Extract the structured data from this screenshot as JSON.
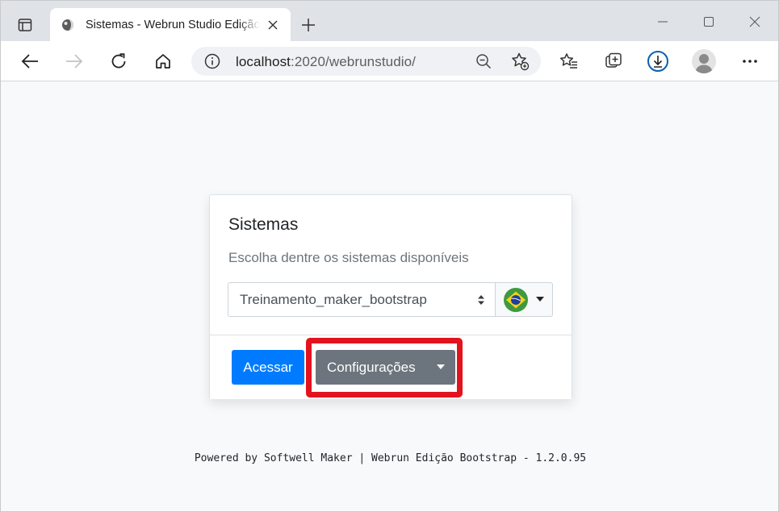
{
  "browser": {
    "tab_title": "Sistemas - Webrun Studio Edição Bootstrap",
    "address_host": "localhost",
    "address_path": ":2020/webrunstudio/"
  },
  "icons": {
    "tab_actions": "tab-actions-icon",
    "favicon": "favicon-icon",
    "tab_close": "close-icon",
    "new_tab": "plus-icon",
    "minimize": "minimize-icon",
    "maximize": "maximize-icon",
    "window_close": "close-icon",
    "back": "arrow-left-icon",
    "forward": "arrow-right-icon",
    "refresh": "refresh-icon",
    "home": "home-icon",
    "site_info": "info-icon",
    "zoom": "zoom-out-icon",
    "add_favorite": "star-add-icon",
    "favorites": "favorites-icon",
    "collections": "collections-icon",
    "downloads": "download-icon",
    "profile": "profile-icon",
    "more": "more-icon",
    "language_flag": "brazil-flag-icon"
  },
  "card": {
    "title": "Sistemas",
    "subtitle": "Escolha dentre os sistemas disponíveis",
    "system_select_value": "Treinamento_maker_bootstrap",
    "acessar_label": "Acessar",
    "config_label": "Configurações"
  },
  "footer": {
    "text": "Powered by Softwell Maker | Webrun Edição Bootstrap - 1.2.0.95"
  },
  "colors": {
    "primary": "#007bff",
    "secondary": "#6c757d",
    "highlight": "#e3131e"
  }
}
